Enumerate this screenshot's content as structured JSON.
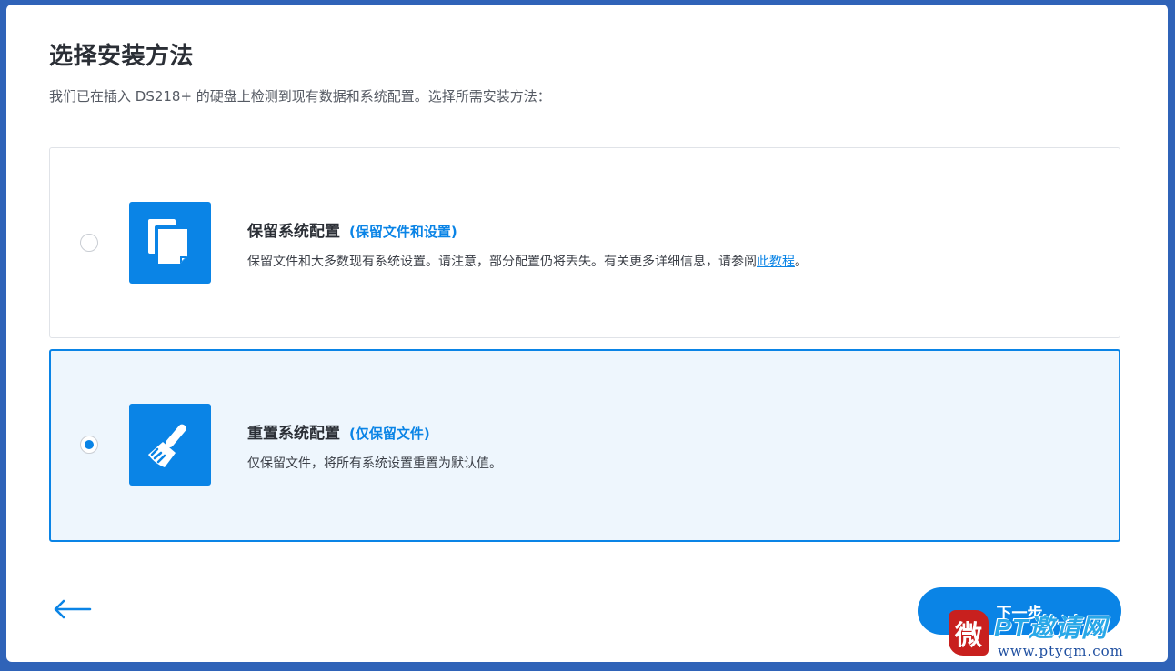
{
  "page": {
    "title": "选择安装方法",
    "subtitle": "我们已在插入 DS218+ 的硬盘上检测到现有数据和系统配置。选择所需安装方法："
  },
  "options": [
    {
      "icon": "copy-files-icon",
      "heading": "保留系统配置",
      "accent": "(保留文件和设置)",
      "description": "保留文件和大多数现有系统设置。请注意，部分配置仍将丢失。有关更多详细信息，请参阅",
      "link_text": "此教程",
      "description_end": "。",
      "selected": false
    },
    {
      "icon": "broom-icon",
      "heading": "重置系统配置",
      "accent": "(仅保留文件)",
      "description": "仅保留文件，将所有系统设置重置为默认值。",
      "selected": true
    }
  ],
  "footer": {
    "back_icon": "arrow-left-icon",
    "next_label": "下一步"
  },
  "watermark": {
    "seal_char": "微",
    "brand": "PT邀请网",
    "url": "www.ptyqm.com"
  },
  "colors": {
    "accent": "#0a84e6",
    "selected_bg": "#eef6fd",
    "frame": "#2f63b8"
  }
}
